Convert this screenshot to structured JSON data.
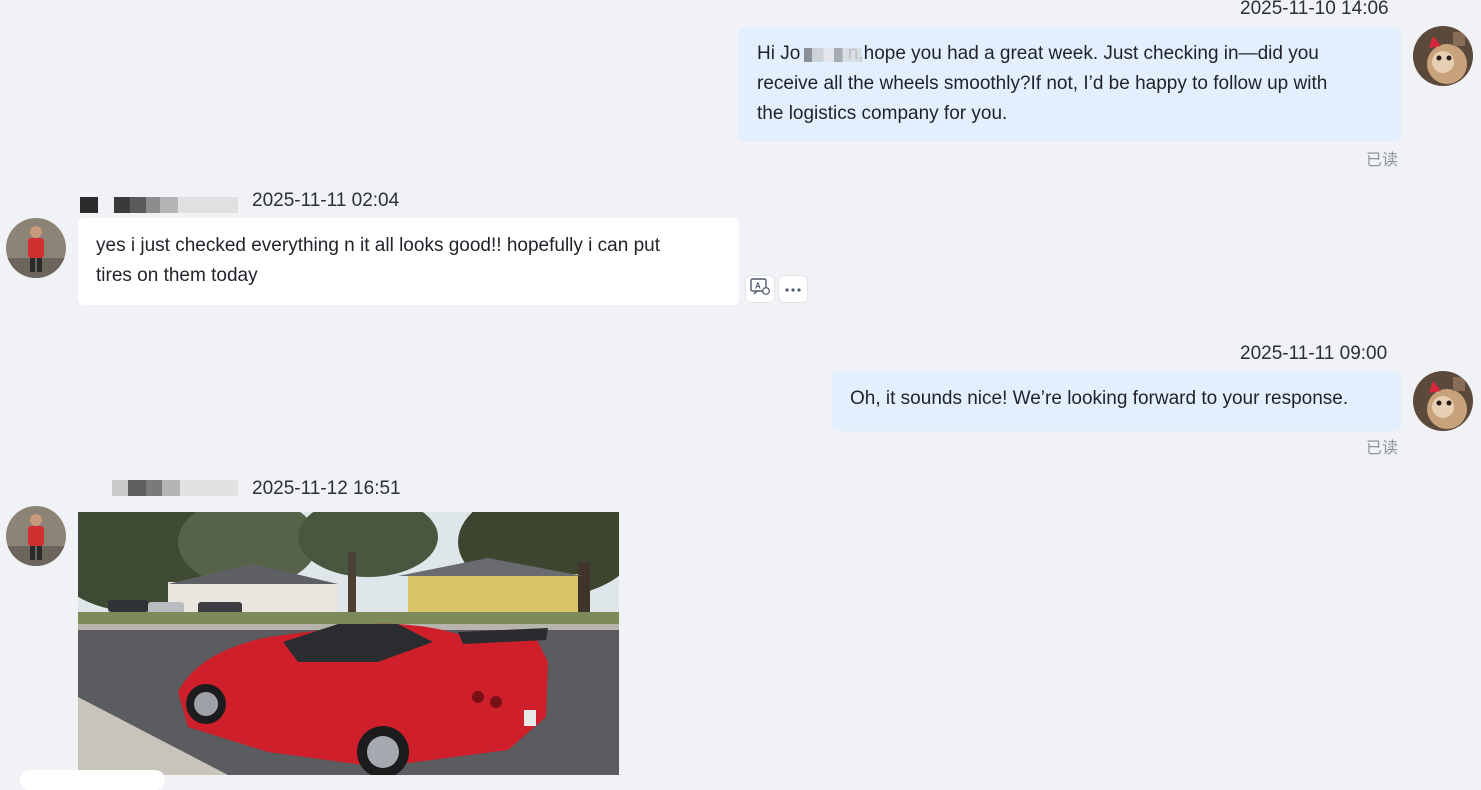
{
  "messages": [
    {
      "direction": "outgoing",
      "timestamp": "2025-11-10 14:06",
      "text": "Hi Jo▪   n,hope you had a great week. Just checking in—did you receive all the wheels smoothly?If not, I’d be happy to follow up with the logistics company for you.",
      "lines": [
        "Hi Jo     n,hope you had a great week. Just checking in—did you",
        "receive all the wheels smoothly?If not, I’d be happy to follow up with",
        "the logistics company for you."
      ],
      "status": "已读"
    },
    {
      "direction": "incoming",
      "timestamp": "2025-11-11 02:04",
      "lines": [
        "yes i just checked everything n it all looks good!! hopefully i can put",
        "tires on them today"
      ]
    },
    {
      "direction": "outgoing",
      "timestamp": "2025-11-11 09:00",
      "text": "Oh, it sounds nice! We’re looking forward to your response.",
      "status": "已读"
    },
    {
      "direction": "incoming",
      "timestamp": "2025-11-12 16:51",
      "attachment": "image"
    }
  ],
  "icons": {
    "translate": "translate-icon",
    "more": "more-icon"
  },
  "colors": {
    "background": "#f1f2f6",
    "outgoing_bubble": "#e3effc",
    "incoming_bubble": "#ffffff",
    "read_status": "#8f959e"
  }
}
